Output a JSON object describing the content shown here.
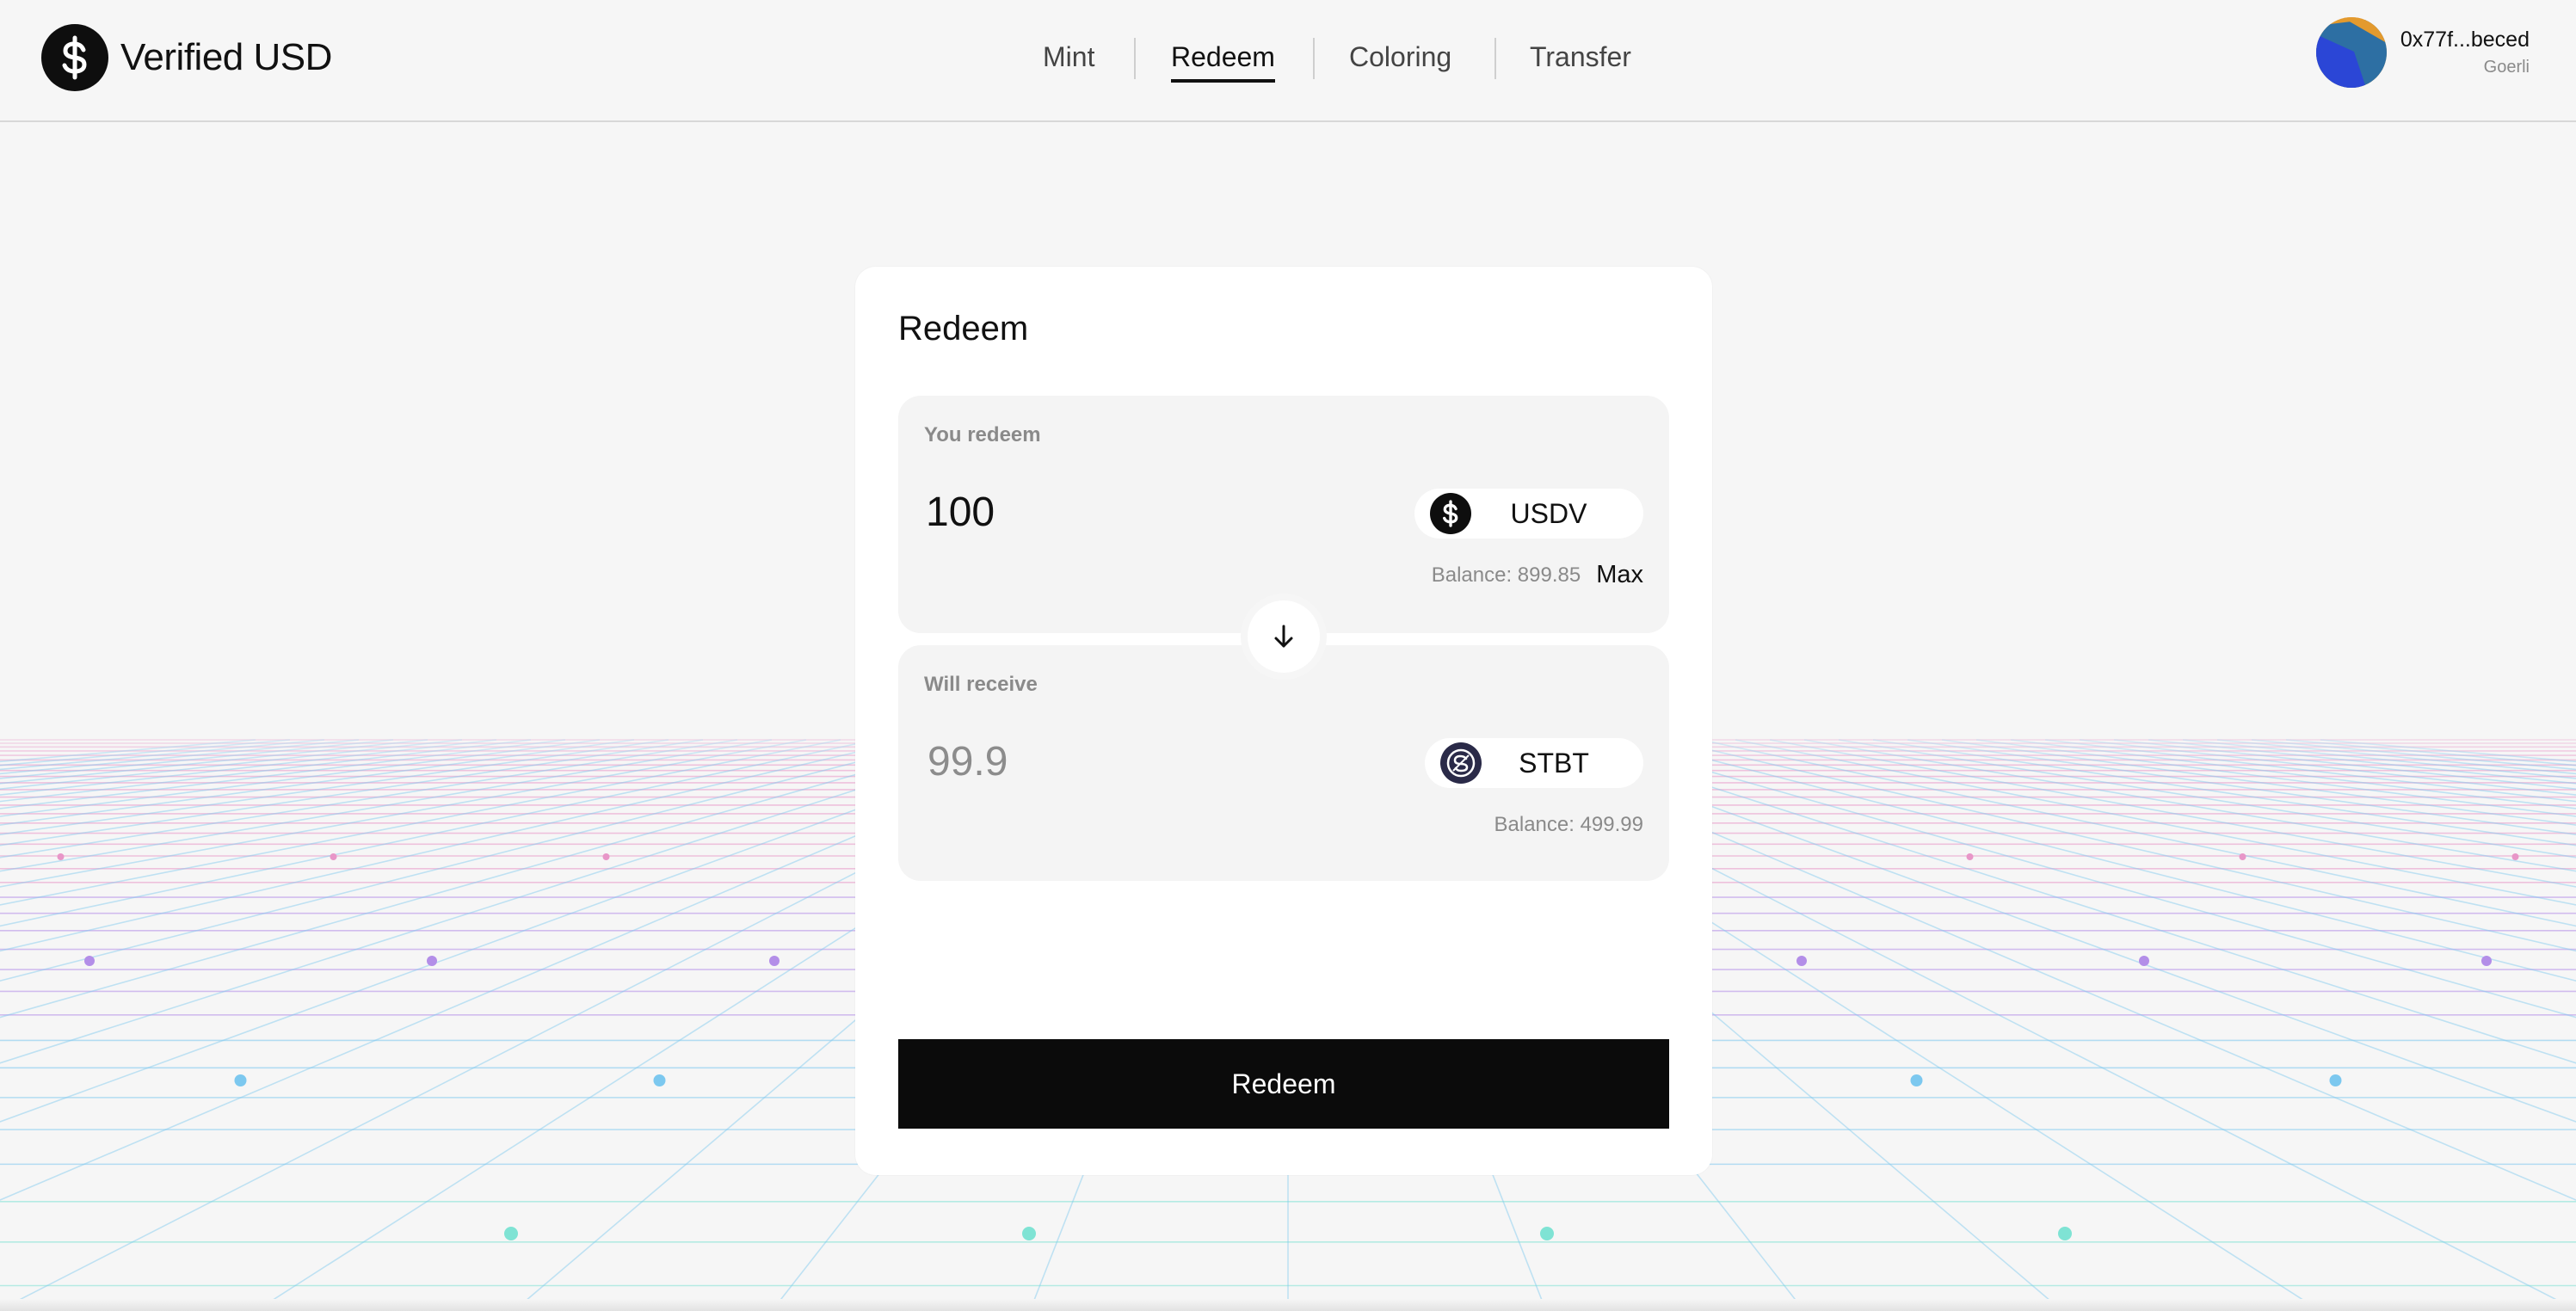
{
  "app": {
    "name": "Verified USD"
  },
  "nav": {
    "items": [
      {
        "label": "Mint",
        "active": false
      },
      {
        "label": "Redeem",
        "active": true
      },
      {
        "label": "Coloring",
        "active": false
      },
      {
        "label": "Transfer",
        "active": false
      }
    ]
  },
  "wallet": {
    "address": "0x77f...beced",
    "network": "Goerli",
    "avatar_colors": [
      "#2d6fa3",
      "#2b46d6",
      "#e39a2e"
    ]
  },
  "redeem_card": {
    "title": "Redeem",
    "from": {
      "label": "You redeem",
      "amount": "100",
      "token": "USDV",
      "token_icon": "dollar-coin-icon",
      "balance": "Balance: 899.85",
      "max_label": "Max"
    },
    "swap_icon": "arrow-down-icon",
    "to": {
      "label": "Will receive",
      "amount": "99.9",
      "token": "STBT",
      "token_icon": "stbt-coin-icon",
      "balance": "Balance: 499.99"
    },
    "submit_label": "Redeem"
  },
  "colors": {
    "accent": "#0b0b0b",
    "background": "#f6f6f6",
    "grid_pink": "#e896c8",
    "grid_purple": "#b38ee8",
    "grid_blue": "#7cc8ef",
    "grid_teal": "#7fe3d4"
  }
}
